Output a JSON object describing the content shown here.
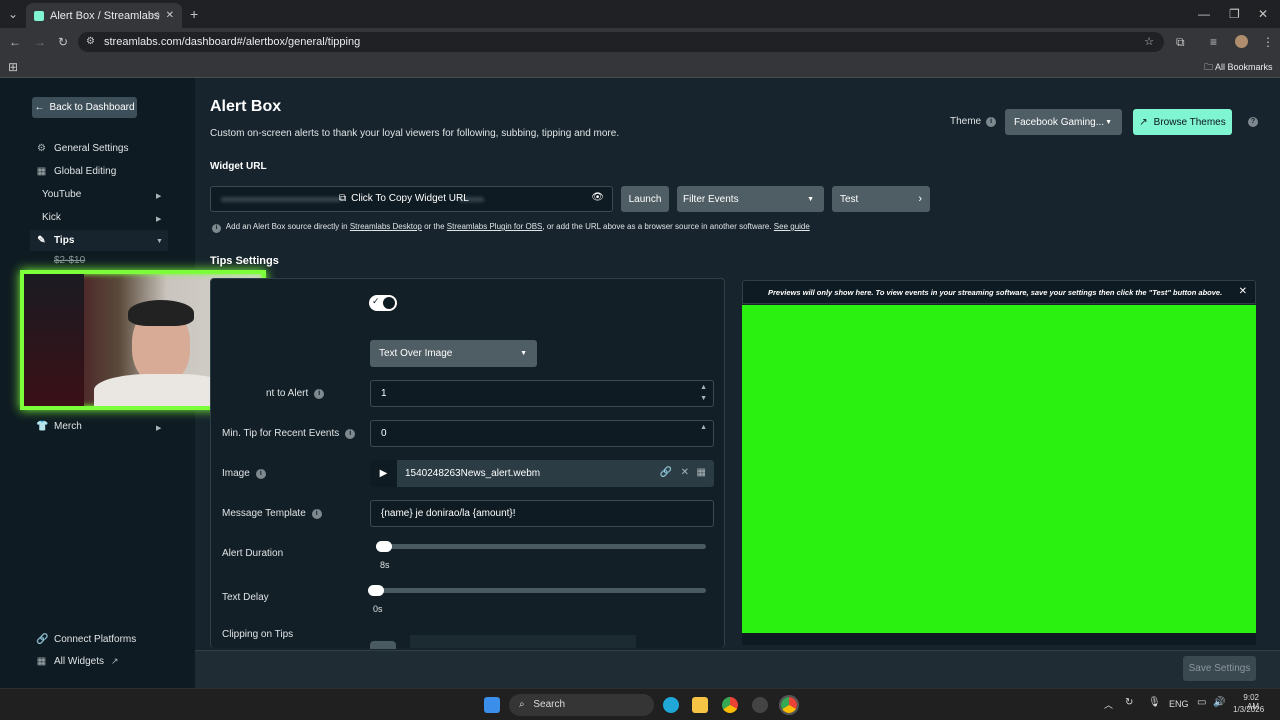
{
  "browser": {
    "tab_title": "Alert Box / Streamlabs",
    "url": "streamlabs.com/dashboard#/alertbox/general/tipping",
    "bookmarks_label": "All Bookmarks"
  },
  "sidebar": {
    "back_label": "Back to Dashboard",
    "items": [
      {
        "label": "General Settings",
        "icon": "gear-icon"
      },
      {
        "label": "Global Editing",
        "icon": "grid-icon"
      },
      {
        "label": "YouTube"
      },
      {
        "label": "Kick"
      },
      {
        "label": "Tips",
        "icon": "tips-icon"
      },
      {
        "label": "$2-$10"
      },
      {
        "label": "Merch",
        "icon": "shirt-icon"
      }
    ],
    "connect_label": "Connect Platforms",
    "all_widgets_label": "All Widgets"
  },
  "header": {
    "title": "Alert Box",
    "subtitle": "Custom on-screen alerts to thank your loyal viewers for following, subbing, tipping and more.",
    "theme_label": "Theme",
    "theme_value": "Facebook Gaming...",
    "browse_themes_label": "Browse Themes"
  },
  "widget": {
    "url_label": "Widget URL",
    "copy_label": "Click To Copy Widget URL",
    "launch_label": "Launch",
    "filter_label": "Filter Events",
    "test_label": "Test",
    "help_prefix": "Add an Alert Box source directly in ",
    "help_link1": "Streamlabs Desktop",
    "help_mid": " or the ",
    "help_link2": "Streamlabs Plugin for OBS",
    "help_suffix": ", or add the URL above as a browser source in another software. ",
    "help_link3": "See guide"
  },
  "tips_settings": {
    "title": "Tips Settings",
    "layout_value": "Text Over Image",
    "min_amount_label": "nt to Alert",
    "min_amount_value": "1",
    "min_recent_label": "Min. Tip for Recent Events",
    "min_recent_value": "0",
    "image_label": "Image",
    "image_value": "1540248263News_alert.webm",
    "template_label": "Message Template",
    "template_value": "{name} je donirao/la {amount}!",
    "duration_label": "Alert Duration",
    "duration_value": "8s",
    "duration_fraction": 0.0,
    "delay_label": "Text Delay",
    "delay_value": "0s",
    "delay_fraction": 0.0,
    "clipping_label": "Clipping on Tips",
    "toggle_on": true
  },
  "preview": {
    "notice": "Previews will only show here. To view events in your streaming software, save your settings then click the \"Test\" button above.",
    "bg_color": "#2af10f"
  },
  "footer": {
    "save_label": "Save Settings"
  },
  "taskbar": {
    "search_label": "Search",
    "lang": "ENG",
    "time": "9:02 AM",
    "date": "1/3/2026"
  },
  "colors": {
    "accent": "#80f5d2",
    "webcam_border": "#7cff3a"
  }
}
